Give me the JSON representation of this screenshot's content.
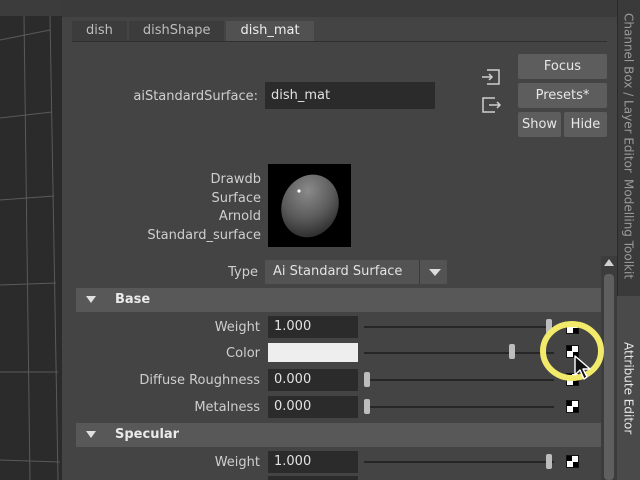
{
  "right_tabs": [
    "Channel Box / Layer Editor",
    "Modelling Toolkit",
    "Attribute Editor"
  ],
  "tabs": [
    {
      "label": "dish",
      "active": false
    },
    {
      "label": "dishShape",
      "active": false
    },
    {
      "label": "dish_mat",
      "active": true
    }
  ],
  "node": {
    "type_label": "aiStandardSurface:",
    "name": "dish_mat"
  },
  "buttons": {
    "focus": "Focus",
    "presets": "Presets*",
    "show": "Show",
    "hide": "Hide"
  },
  "swatch_label": [
    "Drawdb",
    "Surface",
    "Arnold",
    "Standard_surface"
  ],
  "type_field": {
    "label": "Type",
    "value": "Ai Standard Surface"
  },
  "sections": {
    "base": {
      "title": "Base",
      "rows": [
        {
          "label": "Weight",
          "value": "1.000",
          "slider": 1.0
        },
        {
          "label": "Color",
          "value": "",
          "slider": 0.8,
          "color": "#eeeeee"
        },
        {
          "label": "Diffuse Roughness",
          "value": "0.000",
          "slider": 0.0
        },
        {
          "label": "Metalness",
          "value": "0.000",
          "slider": 0.0
        }
      ]
    },
    "specular": {
      "title": "Specular",
      "rows": [
        {
          "label": "Weight",
          "value": "1.000",
          "slider": 1.0
        }
      ]
    }
  },
  "colors": {
    "panel_bg": "#444444",
    "field_bg": "#2b2b2b",
    "section_bg": "#585858",
    "highlight": "#f2ea6a"
  },
  "icons": [
    "load-node-icon",
    "save-node-icon",
    "dropdown-arrow-icon",
    "collapse-triangle-icon",
    "map-button-icon",
    "mouse-cursor-icon",
    "scroll-up-arrow-icon"
  ]
}
